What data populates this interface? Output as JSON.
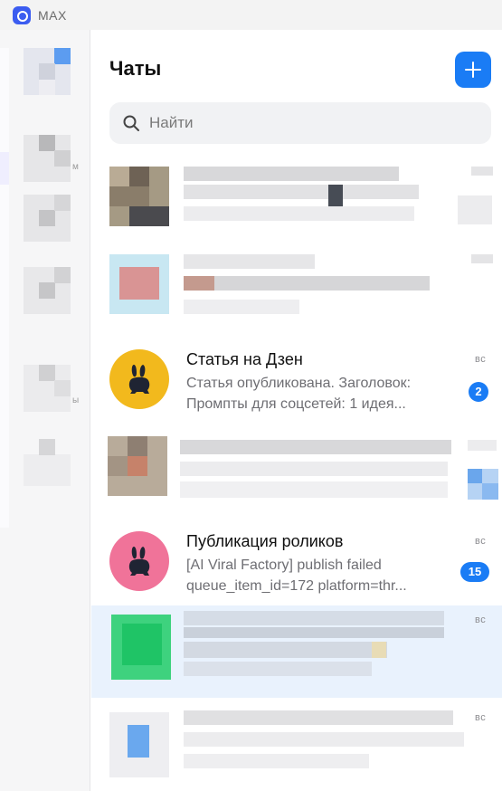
{
  "app": {
    "title": "MAX"
  },
  "header": {
    "title": "Чаты"
  },
  "search": {
    "placeholder": "Найти"
  },
  "sidebar": {
    "labels": [
      "м",
      "ы"
    ]
  },
  "chats": [
    {
      "title": "Статья на Дзен",
      "preview_line1": "Статья опубликована. Заголовок:",
      "preview_line2": "Промпты для соцсетей: 1 идея...",
      "time": "вс",
      "unread": "2",
      "avatar_color": "#f2b91d"
    },
    {
      "title": "Публикация роликов",
      "preview_line1": "[AI Viral Factory] publish failed",
      "preview_line2": "queue_item_id=172 platform=thr...",
      "time": "вс",
      "unread": "15",
      "avatar_color": "#f07399"
    }
  ],
  "blurred_rows": [
    {
      "time": "вс"
    },
    {
      "time": "вс"
    }
  ],
  "colors": {
    "accent": "#1a7cf5",
    "active_row": "#e9f2fd"
  }
}
